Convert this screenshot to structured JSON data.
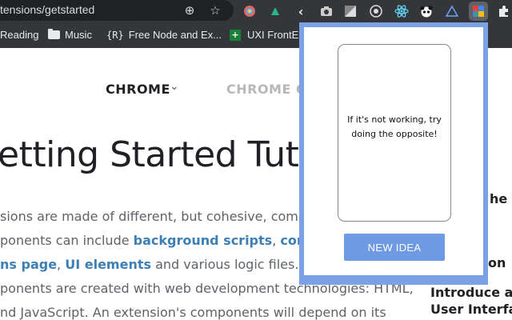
{
  "browser": {
    "url": "tensions/getstarted",
    "extensions_note": "toolbar extension icons",
    "bookmarks": [
      {
        "label": "Reading"
      },
      {
        "label": "Music"
      },
      {
        "glyph": "{R}",
        "label": "Free Node and Ex..."
      },
      {
        "label": "UXI FrontEn"
      }
    ]
  },
  "page": {
    "nav": {
      "chrome": "CHROME",
      "chevron": "⌄",
      "chrome_os": "CHROME OS"
    },
    "title": "etting Started Tutorial",
    "paragraph": {
      "line1": "sions are made of different, but cohesive, compon",
      "line2_pre": "ponents can include ",
      "line2_link1": "background scripts",
      "line2_sep": ", ",
      "line2_link2": "content",
      "line3_link1": "ns page",
      "line3_sep": ", ",
      "line3_link2": "UI elements",
      "line3_post": " and various logic files. Exte",
      "line4": "ponents are created with web development technologies: HTML,",
      "line5": "nd JavaScript. An extension's components will depend on its"
    },
    "sidebar": {
      "fragment1": "he",
      "fragment2": "on",
      "line1": "Introduce a",
      "line2": "User Interfac"
    }
  },
  "popup": {
    "idea": "If it's not working, try doing the opposite!",
    "button_label": "NEW IDEA",
    "colors": {
      "frame": "#7ba1e6",
      "button": "#6e9ae4"
    }
  }
}
